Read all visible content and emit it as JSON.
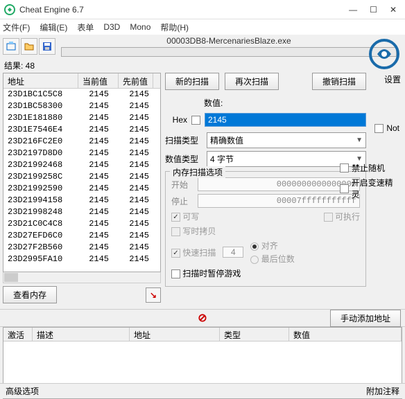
{
  "window": {
    "title": "Cheat Engine 6.7",
    "minimize": "—",
    "maximize": "☐",
    "close": "✕"
  },
  "menu": {
    "file": "文件(F)",
    "edit": "编辑(E)",
    "table": "表单",
    "d3d": "D3D",
    "mono": "Mono",
    "help": "帮助(H)"
  },
  "process": {
    "label": "00003DB8-MercenariesBlaze.exe"
  },
  "settings_label": "设置",
  "results": {
    "label": "结果: 48",
    "headers": {
      "addr": "地址",
      "cur": "当前值",
      "prev": "先前值"
    },
    "rows": [
      {
        "addr": "23D1BC1C5C8",
        "cur": "2145",
        "prev": "2145"
      },
      {
        "addr": "23D1BC58300",
        "cur": "2145",
        "prev": "2145"
      },
      {
        "addr": "23D1E181880",
        "cur": "2145",
        "prev": "2145"
      },
      {
        "addr": "23D1E7546E4",
        "cur": "2145",
        "prev": "2145"
      },
      {
        "addr": "23D216FC2E0",
        "cur": "2145",
        "prev": "2145"
      },
      {
        "addr": "23D2197D8D0",
        "cur": "2145",
        "prev": "2145"
      },
      {
        "addr": "23D21992468",
        "cur": "2145",
        "prev": "2145"
      },
      {
        "addr": "23D2199258C",
        "cur": "2145",
        "prev": "2145"
      },
      {
        "addr": "23D21992590",
        "cur": "2145",
        "prev": "2145"
      },
      {
        "addr": "23D21994158",
        "cur": "2145",
        "prev": "2145"
      },
      {
        "addr": "23D21998248",
        "cur": "2145",
        "prev": "2145"
      },
      {
        "addr": "23D21C0C4C8",
        "cur": "2145",
        "prev": "2145"
      },
      {
        "addr": "23D27EFD6C0",
        "cur": "2145",
        "prev": "2145"
      },
      {
        "addr": "23D27F2B560",
        "cur": "2145",
        "prev": "2145"
      },
      {
        "addr": "23D2995FA10",
        "cur": "2145",
        "prev": "2145"
      }
    ]
  },
  "buttons": {
    "view_memory": "查看内存",
    "new_scan": "新的扫描",
    "next_scan": "再次扫描",
    "undo_scan": "撤销扫描",
    "manual_add": "手动添加地址"
  },
  "value": {
    "label_top": "数值:",
    "hex_label": "Hex",
    "input": "2145"
  },
  "scan": {
    "type_label": "扫描类型",
    "type_value": "精确数值",
    "value_type_label": "数值类型",
    "value_type_value": "4 字节",
    "not_label": "Not"
  },
  "memory": {
    "group_title": "内存扫描选项",
    "start_label": "开始",
    "start_value": "0000000000000000",
    "stop_label": "停止",
    "stop_value": "00007fffffffffff",
    "writable": "可写",
    "executable": "可执行",
    "copy_on_write": "写时拷贝",
    "fast_scan": "快速扫描",
    "fast_scan_value": "4",
    "alignment": "对齐",
    "last_digits": "最后位数",
    "pause_label": "扫描时暂停游戏"
  },
  "side_checks": {
    "disable_random": "禁止随机",
    "enable_speedhack": "开启变速精灵"
  },
  "address_list": {
    "activate": "激活",
    "description": "描述",
    "address": "地址",
    "type": "类型",
    "value": "数值"
  },
  "bottom": {
    "advanced": "高级选项",
    "attach": "附加注释"
  }
}
